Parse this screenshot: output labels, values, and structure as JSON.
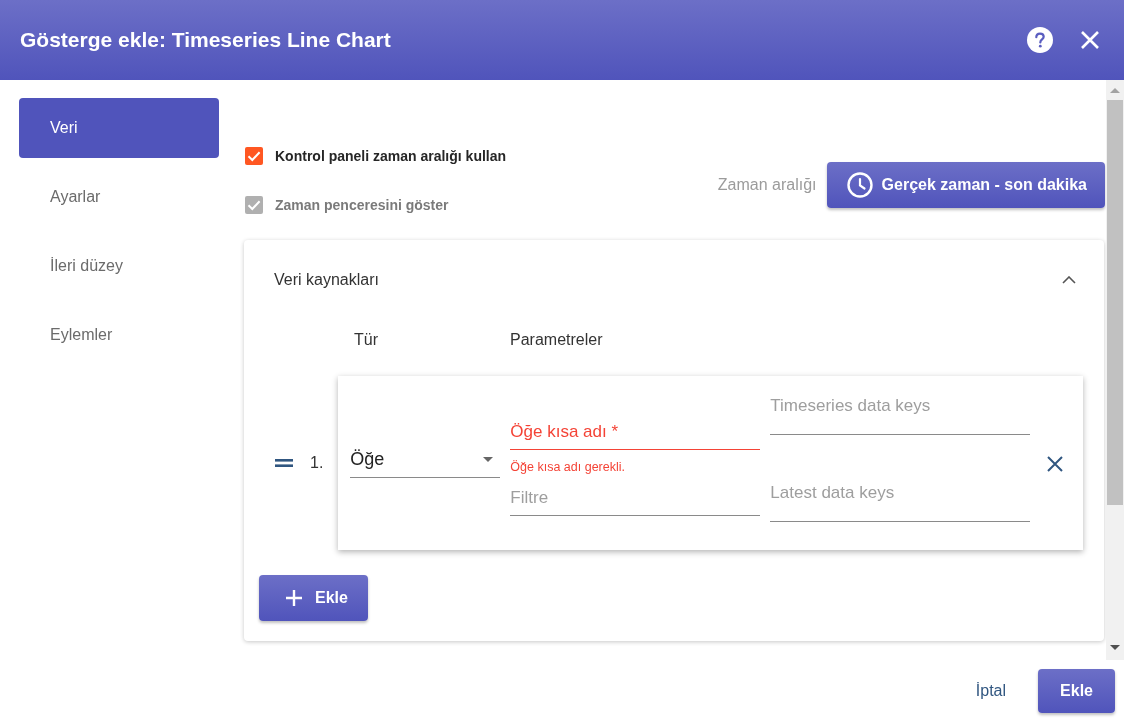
{
  "dialog": {
    "title": "Gösterge ekle: Timeseries Line Chart"
  },
  "sidebar": {
    "items": [
      {
        "label": "Veri",
        "selected": true
      },
      {
        "label": "Ayarlar",
        "selected": false
      },
      {
        "label": "İleri düzey",
        "selected": false
      },
      {
        "label": "Eylemler",
        "selected": false
      }
    ]
  },
  "time_settings": {
    "checkboxes": [
      {
        "label": "Kontrol paneli zaman aralığı kullan",
        "checked": true,
        "disabled": false
      },
      {
        "label": "Zaman penceresini göster",
        "checked": true,
        "disabled": true
      }
    ],
    "range_label": "Zaman aralığı",
    "range_button": "Gerçek zaman - son dakika"
  },
  "datasources": {
    "title": "Veri kaynakları",
    "expanded": true,
    "columns": [
      "Tür",
      "Parametreler"
    ],
    "rows": [
      {
        "index": "1.",
        "type": "Öğe",
        "entity_fields": [
          {
            "placeholder": "Öğe kısa adı *",
            "invalid": true,
            "error": "Öğe kısa adı gerekli."
          },
          {
            "placeholder": "Filtre",
            "invalid": false
          }
        ],
        "key_fields": [
          {
            "placeholder": "Timeseries data keys",
            "invalid": false
          },
          {
            "placeholder": "Latest data keys",
            "invalid": false
          }
        ]
      }
    ],
    "add_button": "Ekle"
  },
  "footer": {
    "cancel": "İptal",
    "confirm": "Ekle"
  }
}
